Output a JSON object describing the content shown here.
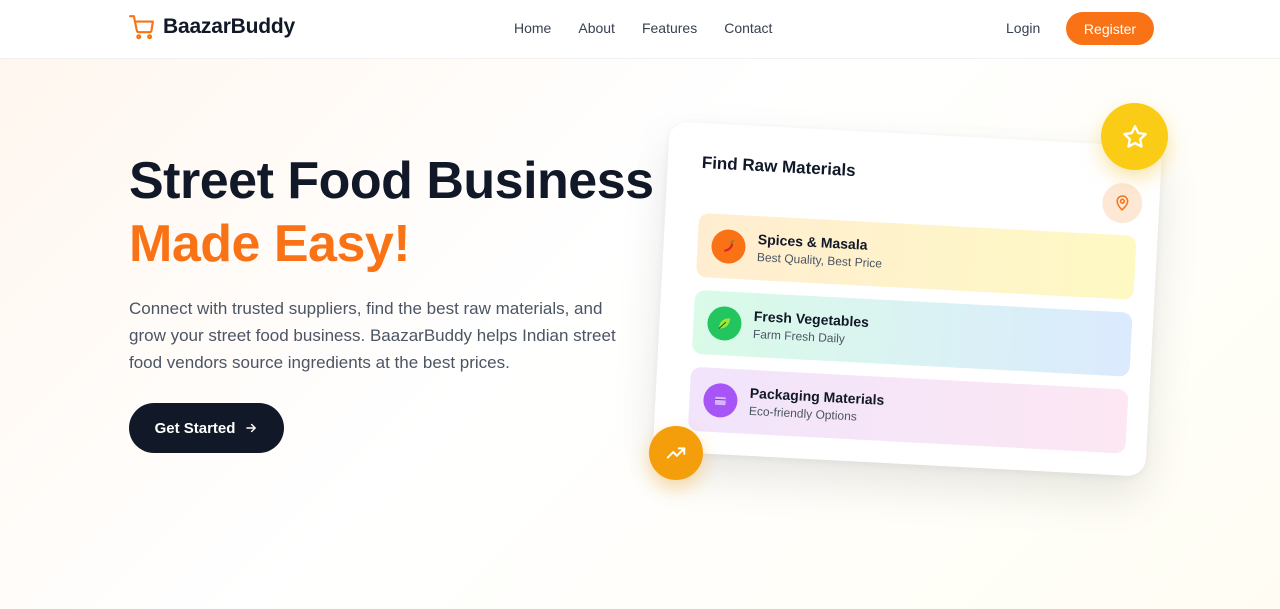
{
  "brand": {
    "name": "BaazarBuddy",
    "logo_icon": "shopping-cart-icon"
  },
  "nav": {
    "links": [
      "Home",
      "About",
      "Features",
      "Contact"
    ],
    "login_label": "Login",
    "register_label": "Register"
  },
  "hero": {
    "title_line1": "Street Food Business",
    "title_line2": "Made Easy!",
    "description": "Connect with trusted suppliers, find the best raw materials, and grow your street food business. BaazarBuddy helps Indian street food vendors source ingredients at the best prices.",
    "cta_label": "Get Started",
    "cta_icon": "arrow-right-icon"
  },
  "card": {
    "title": "Find Raw Materials",
    "pin_icon": "map-pin-icon",
    "items": [
      {
        "name": "Spices & Masala",
        "subtitle": "Best Quality, Best Price",
        "icon": "chili-icon"
      },
      {
        "name": "Fresh Vegetables",
        "subtitle": "Farm Fresh Daily",
        "icon": "leaf-icon"
      },
      {
        "name": "Packaging Materials",
        "subtitle": "Eco-friendly Options",
        "icon": "package-icon"
      }
    ]
  },
  "badges": {
    "top": "star-icon",
    "bottom": "trending-up-icon"
  },
  "colors": {
    "accent": "#f97316",
    "dark": "#111827",
    "star_badge": "#facc15",
    "trend_badge": "#f59e0b"
  }
}
